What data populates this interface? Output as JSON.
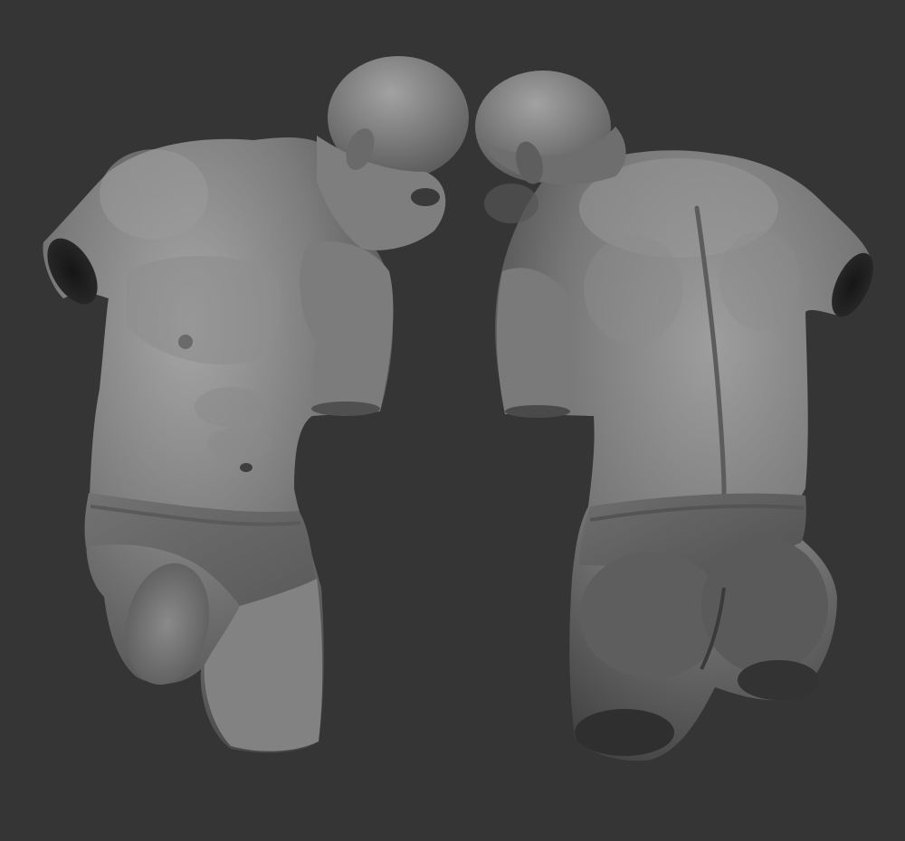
{
  "scene": {
    "background_color": "#353535",
    "material_base": "#7a7a7a",
    "material_highlight": "#a8a8a8",
    "material_shadow": "#2e2e2e",
    "models": [
      {
        "view": "front",
        "subject": "male-torso-sculpt"
      },
      {
        "view": "back",
        "subject": "male-torso-sculpt"
      }
    ]
  }
}
